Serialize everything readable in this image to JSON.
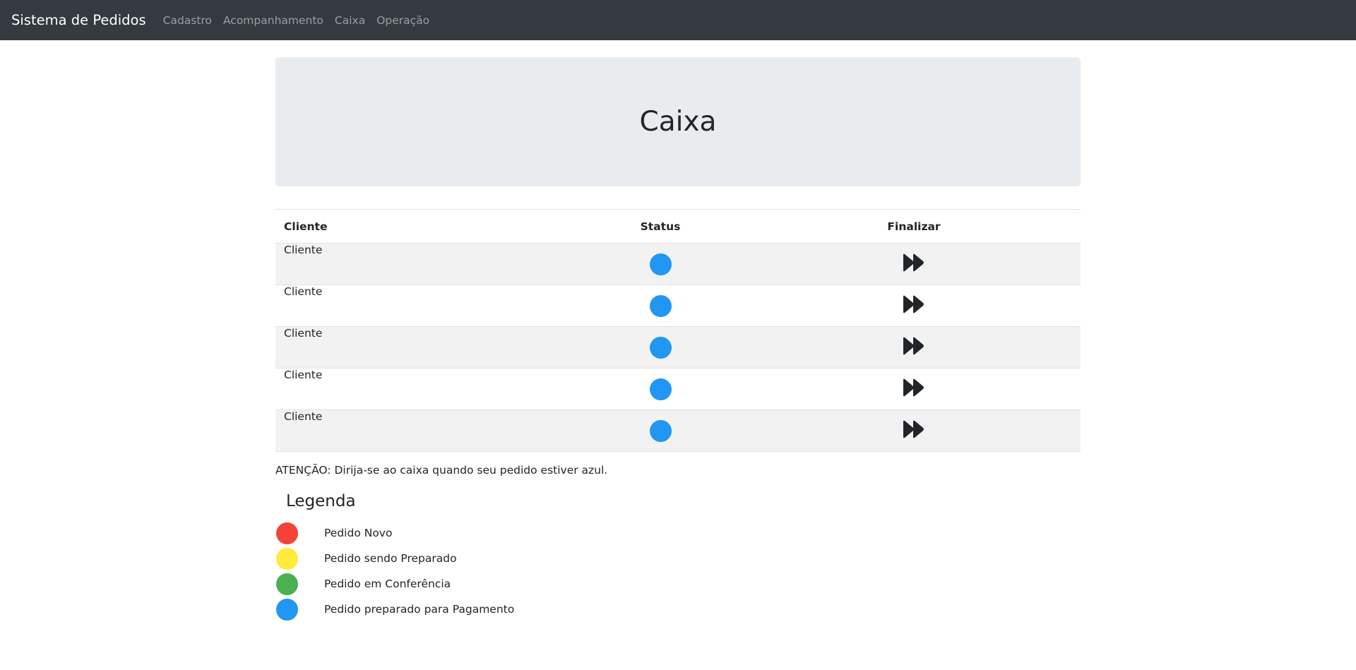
{
  "navbar": {
    "brand": "Sistema de Pedidos",
    "links": [
      "Cadastro",
      "Acompanhamento",
      "Caixa",
      "Operação"
    ]
  },
  "page": {
    "title": "Caixa"
  },
  "table": {
    "headers": {
      "cliente": "Cliente",
      "status": "Status",
      "finalizar": "Finalizar"
    },
    "rows": [
      {
        "cliente": "Cliente",
        "status_color": "#2196f3",
        "action_icon": "fast-forward-icon"
      },
      {
        "cliente": "Cliente",
        "status_color": "#2196f3",
        "action_icon": "fast-forward-icon"
      },
      {
        "cliente": "Cliente",
        "status_color": "#2196f3",
        "action_icon": "fast-forward-icon"
      },
      {
        "cliente": "Cliente",
        "status_color": "#2196f3",
        "action_icon": "fast-forward-icon"
      },
      {
        "cliente": "Cliente",
        "status_color": "#2196f3",
        "action_icon": "fast-forward-icon"
      }
    ]
  },
  "attention": "ATENÇÃO: Dirija-se ao caixa quando seu pedido estiver azul.",
  "legend": {
    "title": "Legenda",
    "items": [
      {
        "label": "Pedido Novo",
        "color": "#f44336"
      },
      {
        "label": "Pedido sendo Preparado",
        "color": "#ffeb3b"
      },
      {
        "label": "Pedido em Conferência",
        "color": "#4caf50"
      },
      {
        "label": "Pedido preparado para Pagamento",
        "color": "#2196f3"
      }
    ]
  },
  "colors": {
    "navbar_bg": "#343a40",
    "jumbotron_bg": "#e9ecef",
    "striped_row": "#f2f2f2"
  }
}
